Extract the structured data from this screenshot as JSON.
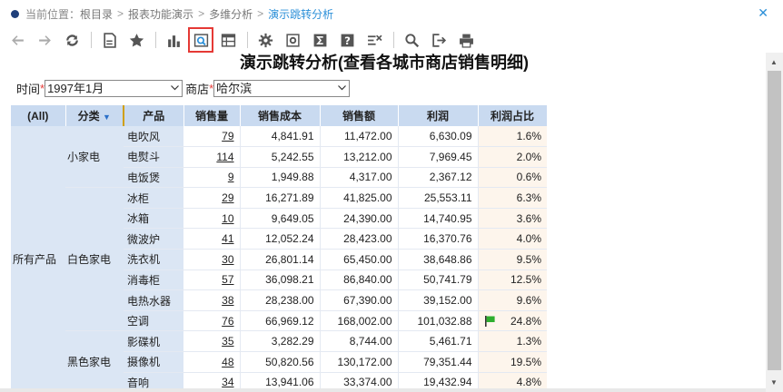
{
  "breadcrumb": {
    "prefix": "当前位置：",
    "items": [
      "根目录",
      "报表功能演示",
      "多维分析"
    ],
    "separator": ">",
    "current": "演示跳转分析",
    "close": "✕"
  },
  "toolbar": {
    "icons": [
      "back-arrow",
      "forward-arrow",
      "refresh",
      "save-report",
      "favorite-star",
      "bar-chart",
      "drill-view",
      "data-grid",
      "settings-gear",
      "advanced-settings",
      "sum-sigma",
      "help-question",
      "clear-filter",
      "search-magnifier",
      "export",
      "print"
    ]
  },
  "report": {
    "title": "演示跳转分析(查看各城市商店销售明细)"
  },
  "filters": {
    "time_label": "时间",
    "time_value": "1997年1月",
    "store_label": "商店",
    "store_value": "哈尔滨",
    "required_mark": "*"
  },
  "table": {
    "headers": {
      "all": "(All)",
      "category": "分类",
      "product": "产品",
      "qty": "销售量",
      "cost": "销售成本",
      "sales": "销售额",
      "profit": "利润",
      "ratio": "利润占比"
    },
    "all_label": "所有产品",
    "categories": [
      {
        "name": "小家电",
        "rows": [
          {
            "product": "电吹风",
            "qty": "79",
            "cost": "4,841.91",
            "sales": "11,472.00",
            "profit": "6,630.09",
            "ratio": "1.6%"
          },
          {
            "product": "电熨斗",
            "qty": "114",
            "cost": "5,242.55",
            "sales": "13,212.00",
            "profit": "7,969.45",
            "ratio": "2.0%"
          },
          {
            "product": "电饭煲",
            "qty": "9",
            "cost": "1,949.88",
            "sales": "4,317.00",
            "profit": "2,367.12",
            "ratio": "0.6%",
            "marker": "lightbulb"
          }
        ]
      },
      {
        "name": "白色家电",
        "rows": [
          {
            "product": "冰柜",
            "qty": "29",
            "cost": "16,271.89",
            "sales": "41,825.00",
            "profit": "25,553.11",
            "ratio": "6.3%"
          },
          {
            "product": "冰箱",
            "qty": "10",
            "cost": "9,649.05",
            "sales": "24,390.00",
            "profit": "14,740.95",
            "ratio": "3.6%"
          },
          {
            "product": "微波炉",
            "qty": "41",
            "cost": "12,052.24",
            "sales": "28,423.00",
            "profit": "16,370.76",
            "ratio": "4.0%"
          },
          {
            "product": "洗衣机",
            "qty": "30",
            "cost": "26,801.14",
            "sales": "65,450.00",
            "profit": "38,648.86",
            "ratio": "9.5%"
          },
          {
            "product": "消毒柜",
            "qty": "57",
            "cost": "36,098.21",
            "sales": "86,840.00",
            "profit": "50,741.79",
            "ratio": "12.5%"
          },
          {
            "product": "电热水器",
            "qty": "38",
            "cost": "28,238.00",
            "sales": "67,390.00",
            "profit": "39,152.00",
            "ratio": "9.6%"
          },
          {
            "product": "空调",
            "qty": "76",
            "cost": "66,969.12",
            "sales": "168,002.00",
            "profit": "101,032.88",
            "ratio": "24.8%",
            "marker": "flag"
          }
        ]
      },
      {
        "name": "黑色家电",
        "rows": [
          {
            "product": "影碟机",
            "qty": "35",
            "cost": "3,282.29",
            "sales": "8,744.00",
            "profit": "5,461.71",
            "ratio": "1.3%"
          },
          {
            "product": "摄像机",
            "qty": "48",
            "cost": "50,820.56",
            "sales": "130,172.00",
            "profit": "79,351.44",
            "ratio": "19.5%"
          },
          {
            "product": "音响",
            "qty": "34",
            "cost": "13,941.06",
            "sales": "33,374.00",
            "profit": "19,432.94",
            "ratio": "4.8%"
          }
        ]
      }
    ]
  },
  "colors": {
    "header_bg": "#c9daf0",
    "dim_bg": "#dbe6f4",
    "ratio_bg": "#fdf5ec",
    "link": "#2b8fd8",
    "highlight_border": "#e53935"
  }
}
